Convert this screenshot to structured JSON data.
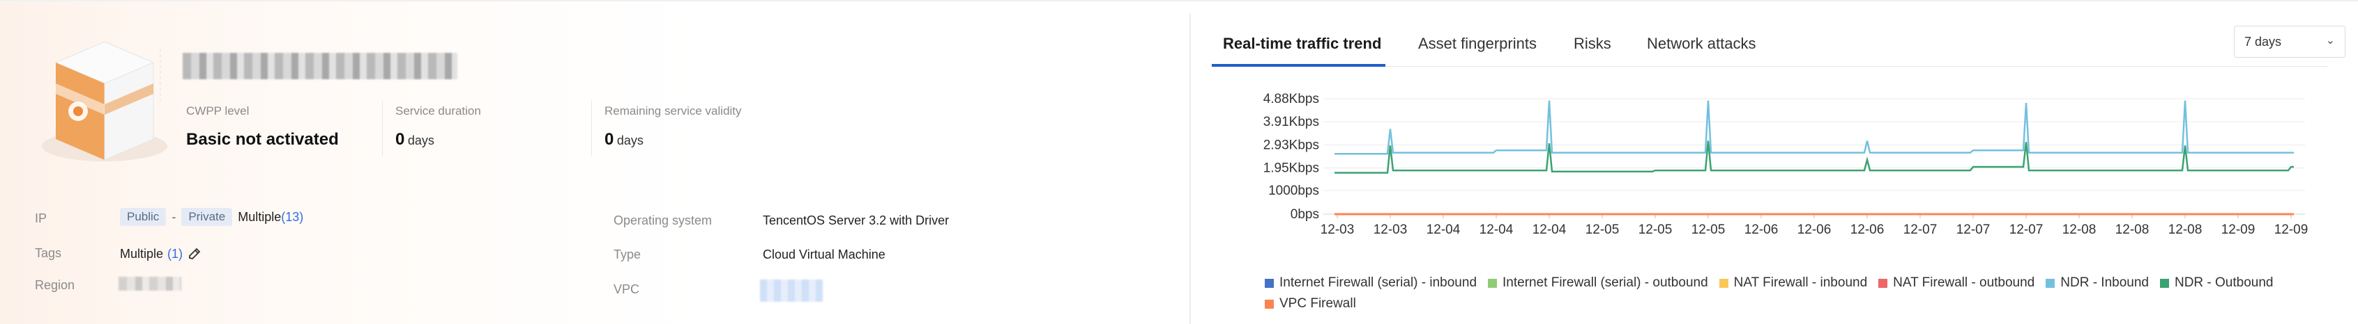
{
  "asset": {
    "cwpp_label": "CWPP level",
    "cwpp_value": "Basic not activated",
    "duration_label": "Service duration",
    "duration_value": "0",
    "duration_unit": "days",
    "validity_label": "Remaining service validity",
    "validity_value": "0",
    "validity_unit": "days"
  },
  "details": {
    "ip_label": "IP",
    "ip_public": "Public",
    "ip_sep": "-",
    "ip_private": "Private",
    "ip_multiple": "Multiple",
    "ip_count": "(13)",
    "tags_label": "Tags",
    "tags_value": "Multiple",
    "tags_count": "(1)",
    "region_label": "Region",
    "os_label": "Operating system",
    "os_value": "TencentOS Server 3.2 with Driver",
    "type_label": "Type",
    "type_value": "Cloud Virtual Machine",
    "vpc_label": "VPC"
  },
  "tabs": [
    "Real-time traffic trend",
    "Asset fingerprints",
    "Risks",
    "Network attacks"
  ],
  "range": {
    "selected": "7 days"
  },
  "colors": {
    "blue_dark": "#4472c4",
    "green_light": "#91cc75",
    "yellow": "#fac858",
    "red": "#ee6666",
    "ndr_in": "#73c0de",
    "ndr_out": "#3ba272",
    "vpc": "#fc8452",
    "active_tab": "#1f5ec9"
  },
  "chart_data": {
    "type": "line",
    "y_ticks": [
      "0bps",
      "1000bps",
      "1.95Kbps",
      "2.93Kbps",
      "3.91Kbps",
      "4.88Kbps"
    ],
    "y_tick_values_kbps": [
      0,
      1.0,
      1.95,
      2.93,
      3.91,
      4.88
    ],
    "ylim_kbps": [
      0,
      4.88
    ],
    "x_ticks": [
      "12-03",
      "12-03",
      "12-04",
      "12-04",
      "12-04",
      "12-05",
      "12-05",
      "12-05",
      "12-06",
      "12-06",
      "12-06",
      "12-07",
      "12-07",
      "12-07",
      "12-08",
      "12-08",
      "12-08",
      "12-09",
      "12-09"
    ],
    "grid": true,
    "series": [
      {
        "name": "Internet Firewall (serial) - inbound",
        "color": "#4472c4",
        "values": [
          0,
          0,
          0,
          0,
          0,
          0,
          0,
          0,
          0,
          0,
          0,
          0,
          0,
          0,
          0,
          0,
          0,
          0,
          0
        ]
      },
      {
        "name": "Internet Firewall (serial) - outbound",
        "color": "#91cc75",
        "values": [
          0,
          0,
          0,
          0,
          0,
          0,
          0,
          0,
          0,
          0,
          0,
          0,
          0,
          0,
          0,
          0,
          0,
          0,
          0
        ]
      },
      {
        "name": "NAT Firewall - inbound",
        "color": "#fac858",
        "values": [
          0,
          0,
          0,
          0,
          0,
          0,
          0,
          0,
          0,
          0,
          0,
          0,
          0,
          0,
          0,
          0,
          0,
          0,
          0
        ]
      },
      {
        "name": "NAT Firewall - outbound",
        "color": "#ee6666",
        "values": [
          0,
          0,
          0,
          0,
          0,
          0,
          0,
          0,
          0,
          0,
          0,
          0,
          0,
          0,
          0,
          0,
          0,
          0,
          0
        ]
      },
      {
        "name": "NDR - Inbound",
        "color": "#73c0de",
        "values": [
          2.55,
          3.6,
          2.6,
          2.7,
          4.8,
          2.6,
          2.6,
          4.8,
          2.6,
          2.6,
          3.1,
          2.6,
          2.7,
          4.7,
          2.6,
          2.6,
          4.8,
          2.6,
          2.6
        ]
      },
      {
        "name": "NDR - Outbound",
        "color": "#3ba272",
        "values": [
          1.75,
          2.9,
          1.85,
          1.85,
          3.0,
          1.8,
          1.85,
          3.1,
          1.85,
          1.85,
          2.3,
          1.85,
          2.0,
          3.05,
          1.85,
          1.85,
          2.9,
          1.85,
          2.0
        ]
      },
      {
        "name": "VPC Firewall",
        "color": "#fc8452",
        "values": [
          0,
          0,
          0,
          0,
          0,
          0,
          0,
          0,
          0,
          0,
          0,
          0,
          0,
          0,
          0,
          0,
          0,
          0,
          0
        ]
      }
    ]
  }
}
